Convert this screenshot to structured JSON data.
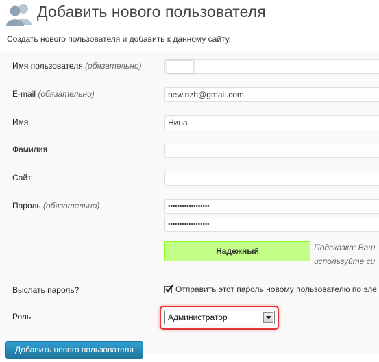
{
  "header": {
    "title": "Добавить нового пользователя",
    "description": "Создать нового пользователя и добавить к данному сайту."
  },
  "form": {
    "username": {
      "label": "Имя пользователя",
      "required": "(обязательно)",
      "value": ""
    },
    "email": {
      "label": "E-mail",
      "required": "(обязательно)",
      "value": "new.nzh@gmail.com"
    },
    "first_name": {
      "label": "Имя",
      "value": "Нина"
    },
    "last_name": {
      "label": "Фамилия",
      "value": ""
    },
    "website": {
      "label": "Сайт",
      "value": ""
    },
    "password": {
      "label": "Пароль",
      "required": "(обязательно)",
      "value1": "••••••••••••••••••",
      "value2": "••••••••••••••••••",
      "strength": "Надежный",
      "hint_line1": "Подсказка: Ваш",
      "hint_line2": "используйте си"
    },
    "send_password": {
      "label": "Выслать пароль?",
      "checkbox_label": "Отправить этот пароль новому пользователю по эле",
      "checked": true
    },
    "role": {
      "label": "Роль",
      "selected": "Администратор"
    },
    "submit_label": "Добавить нового пользователя"
  },
  "colors": {
    "submit_bg": "#21759b",
    "strength_bg": "#c3ff88",
    "role_highlight": "#e5363a"
  },
  "icons": {
    "header": "users-icon",
    "select": "chevron-down-icon",
    "checkbox": "check-icon"
  }
}
